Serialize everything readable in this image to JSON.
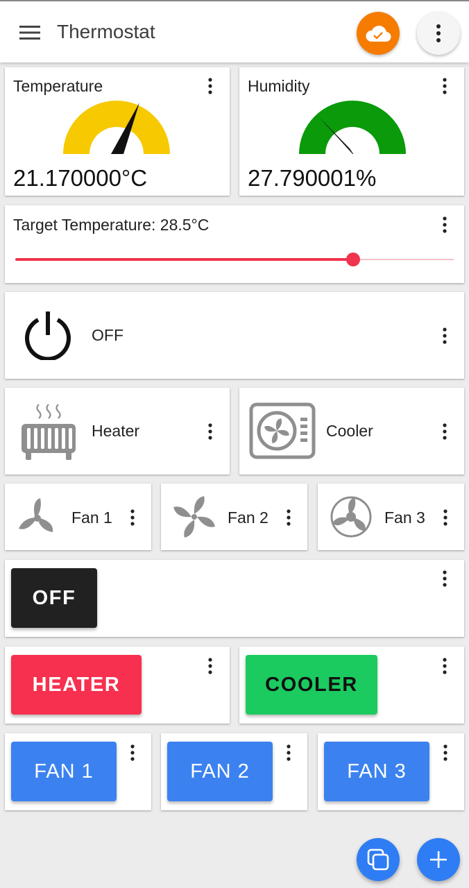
{
  "app": {
    "title": "Thermostat",
    "menu_icon": "hamburger-menu-icon",
    "cloud_icon": "cloud-check-icon",
    "more_icon": "more-vertical-icon",
    "colors": {
      "cloud": "#f57c00",
      "fab": "#2f7df4"
    }
  },
  "gauges": [
    {
      "label": "Temperature",
      "value": "21.170000°C",
      "gauge_fraction": 0.74,
      "color": "#f7c900"
    },
    {
      "label": "Humidity",
      "value": "27.790001%",
      "gauge_fraction": 0.28,
      "color": "#0a9a0a"
    }
  ],
  "target": {
    "label": "Target Temperature: 28.5°C",
    "slider_fraction": 0.77,
    "color": "#f0344e"
  },
  "power": {
    "label": "OFF",
    "icon": "power-icon"
  },
  "devices": [
    {
      "label": "Heater",
      "icon": "radiator-icon"
    },
    {
      "label": "Cooler",
      "icon": "air-conditioner-icon"
    }
  ],
  "fans": [
    {
      "label": "Fan 1",
      "icon": "fan-3-blade-icon"
    },
    {
      "label": "Fan 2",
      "icon": "fan-4-blade-icon"
    },
    {
      "label": "Fan 3",
      "icon": "fan-guard-icon"
    }
  ],
  "buttons": {
    "power": {
      "label": "OFF",
      "color": "#212121",
      "text_color": "#ffffff"
    },
    "heater": {
      "label": "HEATER",
      "color": "#f7304f",
      "text_color": "#ffffff"
    },
    "cooler": {
      "label": "COOLER",
      "color": "#1ccb5f",
      "text_color": "#111111"
    },
    "fans": [
      {
        "label": "FAN 1",
        "color": "#3b82f0",
        "text_color": "#ffffff"
      },
      {
        "label": "FAN 2",
        "color": "#3b82f0",
        "text_color": "#ffffff"
      },
      {
        "label": "FAN 3",
        "color": "#3b82f0",
        "text_color": "#ffffff"
      }
    ]
  },
  "fabs": [
    {
      "icon": "copy-icon"
    },
    {
      "icon": "plus-icon"
    }
  ]
}
